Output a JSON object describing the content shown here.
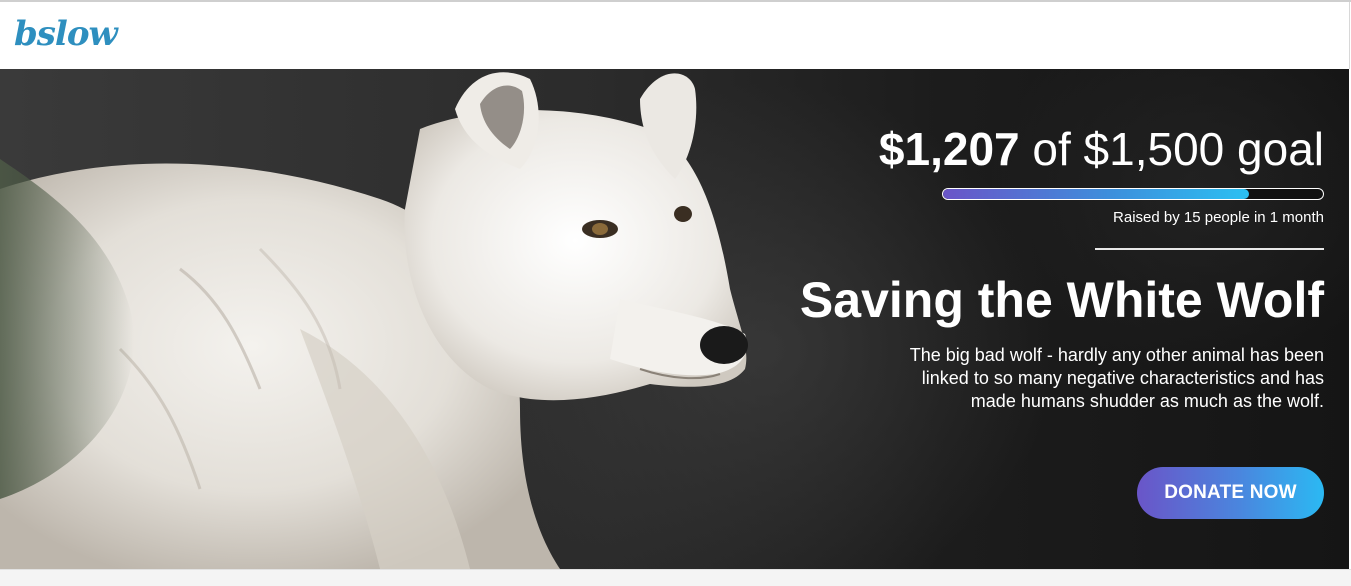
{
  "header": {
    "logo_text": "bslow"
  },
  "campaign": {
    "raised_amount": "$1,207",
    "goal_text": " of $1,500 goal",
    "progress_fraction": 0.805,
    "raised_by": "Raised by 15 people in 1 month",
    "title": "Saving the White Wolf",
    "description": "The big bad wolf - hardly any other animal has been linked to so many negative characteristics and has made humans shudder as much as the wolf.",
    "donate_label": "DONATE NOW"
  },
  "colors": {
    "brand": "#2e8fbf",
    "accent_start": "#6a55c8",
    "accent_end": "#2bc0f2"
  },
  "hero_image": "white-wolf-photo"
}
